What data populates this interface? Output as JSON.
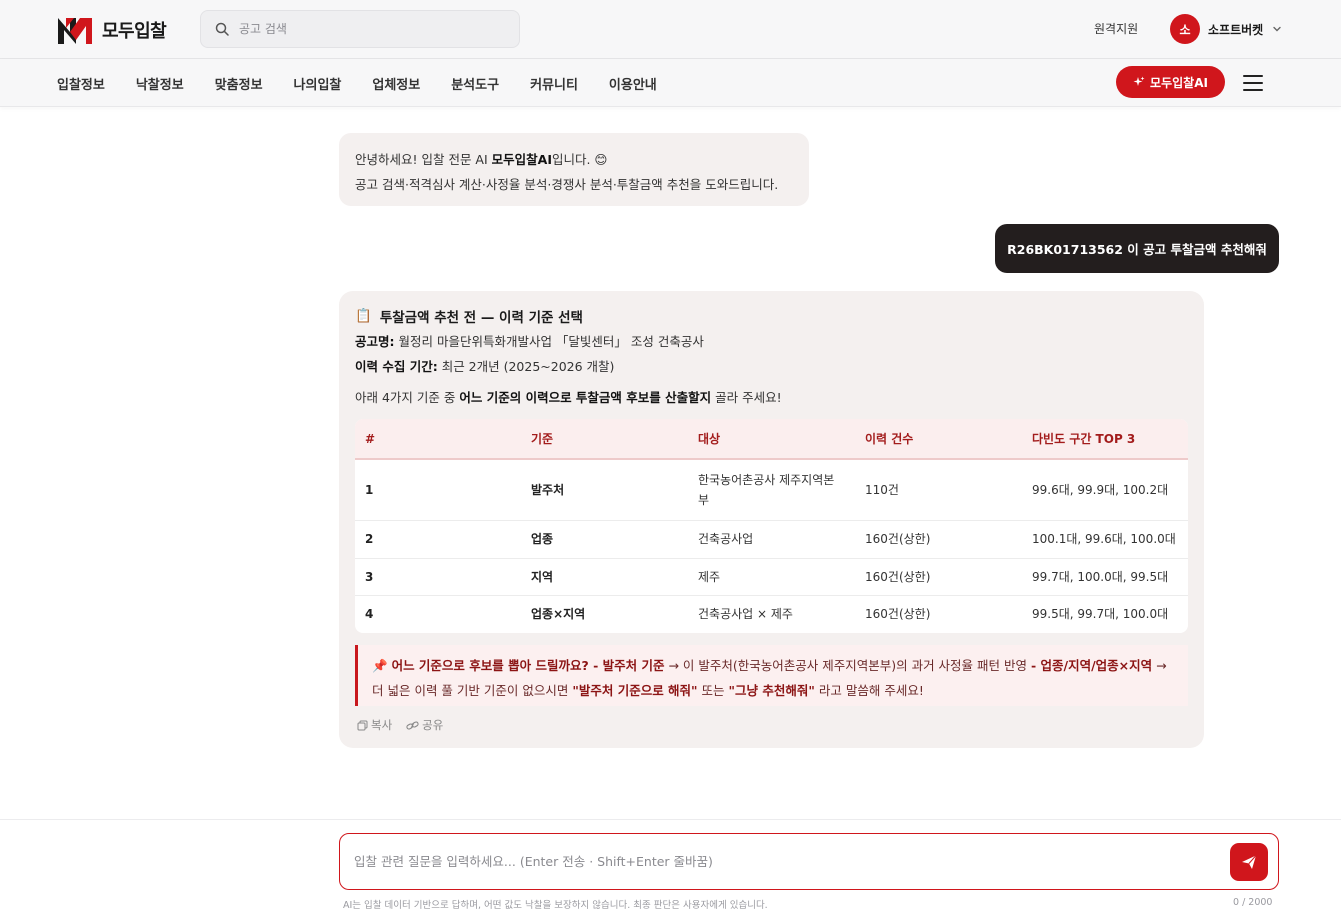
{
  "header": {
    "logo_text": "모두입찰",
    "search_placeholder": "공고 검색",
    "remote_support": "원격지원",
    "user_initial": "소",
    "user_name": "소프트버켓"
  },
  "nav": {
    "items": [
      "입찰정보",
      "낙찰정보",
      "맞춤정보",
      "나의입찰",
      "업체정보",
      "분석도구",
      "커뮤니티",
      "이용안내"
    ],
    "ai_button": "모두입찰AI"
  },
  "chat": {
    "greeting": {
      "pre": "안녕하세요! 입찰 전문 AI ",
      "brand": "모두입찰AI",
      "post": "입니다. 😊",
      "line2": "공고 검색·적격심사 계산·사정율 분석·경쟁사 분석·투찰금액 추천을 도와드립니다."
    },
    "user_message": "R26BK01713562 이 공고 투찰금액 추천해줘",
    "response": {
      "title_icon": "📋",
      "title": "투찰금액 추천 전 — 이력 기준 선택",
      "notice_label": "공고명:",
      "notice_value": "월정리 마을단위특화개발사업 「달빛센터」 조성 건축공사",
      "period_label": "이력 수집 기간:",
      "period_value": "최근 2개년 (2025~2026 개찰)",
      "prompt_pre": "아래 4가지 기준 중 ",
      "prompt_bold": "어느 기준의 이력으로 투찰금액 후보를 산출할지",
      "prompt_post": " 골라 주세요!",
      "table": {
        "headers": [
          "#",
          "기준",
          "대상",
          "이력 건수",
          "다빈도 구간 TOP 3"
        ],
        "rows": [
          [
            "1",
            "발주처",
            "한국농어촌공사 제주지역본부",
            "110건",
            "99.6대, 99.9대, 100.2대"
          ],
          [
            "2",
            "업종",
            "건축공사업",
            "160건(상한)",
            "100.1대, 99.6대, 100.0대"
          ],
          [
            "3",
            "지역",
            "제주",
            "160건(상한)",
            "99.7대, 100.0대, 99.5대"
          ],
          [
            "4",
            "업종×지역",
            "건축공사업 × 제주",
            "160건(상한)",
            "99.5대, 99.7대, 100.0대"
          ]
        ]
      },
      "callout": {
        "icon": "📌",
        "q": "어느 기준으로 후보를 뽑아 드릴까요? - 발주처 기준",
        "arrow1": " → 이 발주처(한국농어촌공사 제주지역본부)의 과거 사정율 패턴 반영 ",
        "b2": "- 업종/지역/업종×지역",
        "arrow2": " → 더 넓은 이력 풀 기반 기준이 없으시면 ",
        "q1": "\"발주처 기준으로 해줘\"",
        "or": " 또는 ",
        "q2": "\"그냥 추천해줘\"",
        "end": " 라고 말씀해 주세요!"
      },
      "actions": {
        "copy": "복사",
        "share": "공유"
      }
    }
  },
  "composer": {
    "placeholder": "입찰 관련 질문을 입력하세요... (Enter 전송 · Shift+Enter 줄바꿈)",
    "disclaimer": "AI는 입찰 데이터 기반으로 답하며, 어떤 값도 낙찰을 보장하지 않습니다. 최종 판단은 사용자에게 있습니다.",
    "counter": "0 / 2000"
  },
  "colors": {
    "brand": "#d0161c",
    "user_bubble": "#231e1e",
    "ai_bubble": "#f4f0ef"
  }
}
